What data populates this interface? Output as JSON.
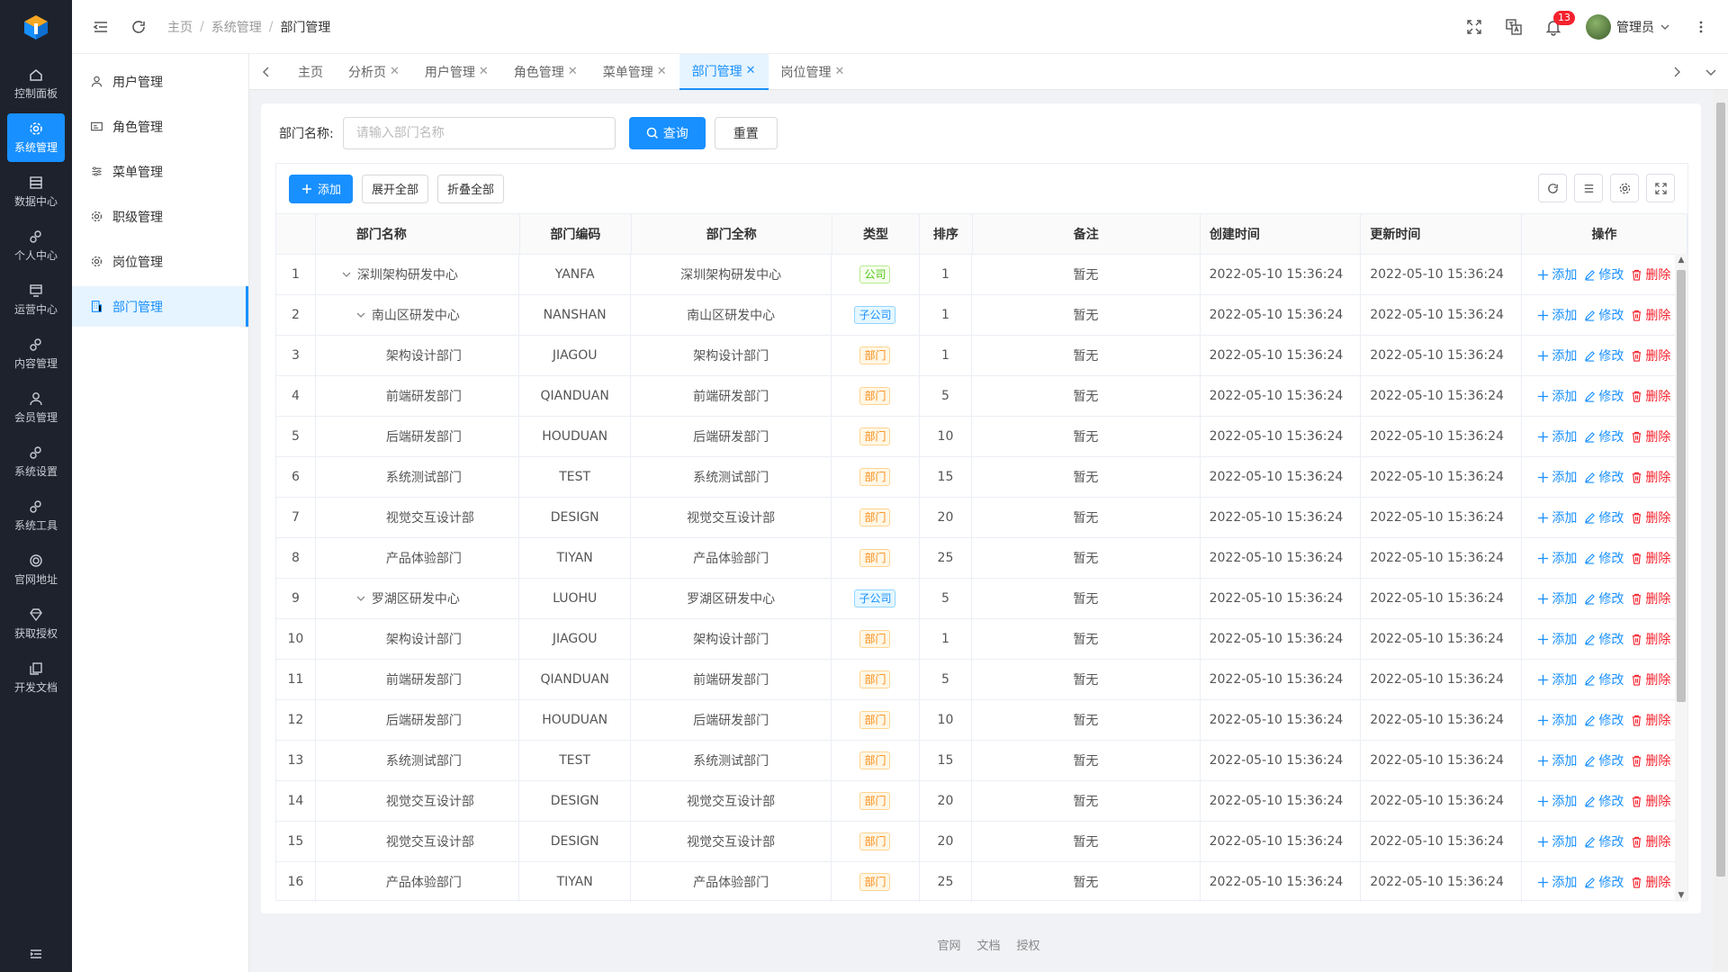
{
  "rail": {
    "items": [
      {
        "label": "控制面板",
        "icon": "home-icon",
        "active": false
      },
      {
        "label": "系统管理",
        "icon": "gear-icon",
        "active": true
      },
      {
        "label": "数据中心",
        "icon": "database-icon",
        "active": false
      },
      {
        "label": "个人中心",
        "icon": "gears-icon",
        "active": false
      },
      {
        "label": "运营中心",
        "icon": "monitor-icon",
        "active": false
      },
      {
        "label": "内容管理",
        "icon": "gears-icon",
        "active": false
      },
      {
        "label": "会员管理",
        "icon": "user-icon",
        "active": false
      },
      {
        "label": "系统设置",
        "icon": "gears-icon",
        "active": false
      },
      {
        "label": "系统工具",
        "icon": "gears-icon",
        "active": false
      },
      {
        "label": "官网地址",
        "icon": "target-icon",
        "active": false
      },
      {
        "label": "获取授权",
        "icon": "diamond-icon",
        "active": false
      },
      {
        "label": "开发文档",
        "icon": "copy-icon",
        "active": false
      }
    ]
  },
  "submenu": {
    "items": [
      {
        "label": "用户管理",
        "icon": "user-icon",
        "active": false
      },
      {
        "label": "角色管理",
        "icon": "id-card-icon",
        "active": false
      },
      {
        "label": "菜单管理",
        "icon": "sliders-icon",
        "active": false
      },
      {
        "label": "职级管理",
        "icon": "gear-icon",
        "active": false
      },
      {
        "label": "岗位管理",
        "icon": "gear-icon",
        "active": false
      },
      {
        "label": "部门管理",
        "icon": "building-icon",
        "active": true
      }
    ]
  },
  "header": {
    "breadcrumb": [
      "主页",
      "系统管理",
      "部门管理"
    ],
    "notification_count": "13",
    "user_name": "管理员"
  },
  "tabs": [
    {
      "label": "主页",
      "closable": false,
      "active": false
    },
    {
      "label": "分析页",
      "closable": true,
      "active": false
    },
    {
      "label": "用户管理",
      "closable": true,
      "active": false
    },
    {
      "label": "角色管理",
      "closable": true,
      "active": false
    },
    {
      "label": "菜单管理",
      "closable": true,
      "active": false
    },
    {
      "label": "部门管理",
      "closable": true,
      "active": true
    },
    {
      "label": "岗位管理",
      "closable": true,
      "active": false
    }
  ],
  "search": {
    "label": "部门名称:",
    "placeholder": "请输入部门名称",
    "value": "",
    "query_label": "查询",
    "reset_label": "重置"
  },
  "toolbar": {
    "add_label": "添加",
    "expand_label": "展开全部",
    "collapse_label": "折叠全部"
  },
  "table": {
    "columns": [
      "部门名称",
      "部门编码",
      "部门全称",
      "类型",
      "排序",
      "备注",
      "创建时间",
      "更新时间",
      "操作"
    ],
    "ops": {
      "add": "添加",
      "edit": "修改",
      "delete": "删除"
    },
    "rows": [
      {
        "idx": "1",
        "name": "深圳架构研发中心",
        "level": 0,
        "expand": true,
        "code": "YANFA",
        "full": "深圳架构研发中心",
        "type": "公司",
        "tag": "company",
        "sort": "1",
        "remark": "暂无",
        "created": "2022-05-10 15:36:24",
        "updated": "2022-05-10 15:36:24"
      },
      {
        "idx": "2",
        "name": "南山区研发中心",
        "level": 1,
        "expand": true,
        "code": "NANSHAN",
        "full": "南山区研发中心",
        "type": "子公司",
        "tag": "sub",
        "sort": "1",
        "remark": "暂无",
        "created": "2022-05-10 15:36:24",
        "updated": "2022-05-10 15:36:24"
      },
      {
        "idx": "3",
        "name": "架构设计部门",
        "level": 2,
        "expand": false,
        "code": "JIAGOU",
        "full": "架构设计部门",
        "type": "部门",
        "tag": "dept",
        "sort": "1",
        "remark": "暂无",
        "created": "2022-05-10 15:36:24",
        "updated": "2022-05-10 15:36:24"
      },
      {
        "idx": "4",
        "name": "前端研发部门",
        "level": 2,
        "expand": false,
        "code": "QIANDUAN",
        "full": "前端研发部门",
        "type": "部门",
        "tag": "dept",
        "sort": "5",
        "remark": "暂无",
        "created": "2022-05-10 15:36:24",
        "updated": "2022-05-10 15:36:24"
      },
      {
        "idx": "5",
        "name": "后端研发部门",
        "level": 2,
        "expand": false,
        "code": "HOUDUAN",
        "full": "后端研发部门",
        "type": "部门",
        "tag": "dept",
        "sort": "10",
        "remark": "暂无",
        "created": "2022-05-10 15:36:24",
        "updated": "2022-05-10 15:36:24"
      },
      {
        "idx": "6",
        "name": "系统测试部门",
        "level": 2,
        "expand": false,
        "code": "TEST",
        "full": "系统测试部门",
        "type": "部门",
        "tag": "dept",
        "sort": "15",
        "remark": "暂无",
        "created": "2022-05-10 15:36:24",
        "updated": "2022-05-10 15:36:24"
      },
      {
        "idx": "7",
        "name": "视觉交互设计部",
        "level": 2,
        "expand": false,
        "code": "DESIGN",
        "full": "视觉交互设计部",
        "type": "部门",
        "tag": "dept",
        "sort": "20",
        "remark": "暂无",
        "created": "2022-05-10 15:36:24",
        "updated": "2022-05-10 15:36:24"
      },
      {
        "idx": "8",
        "name": "产品体验部门",
        "level": 2,
        "expand": false,
        "code": "TIYAN",
        "full": "产品体验部门",
        "type": "部门",
        "tag": "dept",
        "sort": "25",
        "remark": "暂无",
        "created": "2022-05-10 15:36:24",
        "updated": "2022-05-10 15:36:24"
      },
      {
        "idx": "9",
        "name": "罗湖区研发中心",
        "level": 1,
        "expand": true,
        "code": "LUOHU",
        "full": "罗湖区研发中心",
        "type": "子公司",
        "tag": "sub",
        "sort": "5",
        "remark": "暂无",
        "created": "2022-05-10 15:36:24",
        "updated": "2022-05-10 15:36:24"
      },
      {
        "idx": "10",
        "name": "架构设计部门",
        "level": 2,
        "expand": false,
        "code": "JIAGOU",
        "full": "架构设计部门",
        "type": "部门",
        "tag": "dept",
        "sort": "1",
        "remark": "暂无",
        "created": "2022-05-10 15:36:24",
        "updated": "2022-05-10 15:36:24"
      },
      {
        "idx": "11",
        "name": "前端研发部门",
        "level": 2,
        "expand": false,
        "code": "QIANDUAN",
        "full": "前端研发部门",
        "type": "部门",
        "tag": "dept",
        "sort": "5",
        "remark": "暂无",
        "created": "2022-05-10 15:36:24",
        "updated": "2022-05-10 15:36:24"
      },
      {
        "idx": "12",
        "name": "后端研发部门",
        "level": 2,
        "expand": false,
        "code": "HOUDUAN",
        "full": "后端研发部门",
        "type": "部门",
        "tag": "dept",
        "sort": "10",
        "remark": "暂无",
        "created": "2022-05-10 15:36:24",
        "updated": "2022-05-10 15:36:24"
      },
      {
        "idx": "13",
        "name": "系统测试部门",
        "level": 2,
        "expand": false,
        "code": "TEST",
        "full": "系统测试部门",
        "type": "部门",
        "tag": "dept",
        "sort": "15",
        "remark": "暂无",
        "created": "2022-05-10 15:36:24",
        "updated": "2022-05-10 15:36:24"
      },
      {
        "idx": "14",
        "name": "视觉交互设计部",
        "level": 2,
        "expand": false,
        "code": "DESIGN",
        "full": "视觉交互设计部",
        "type": "部门",
        "tag": "dept",
        "sort": "20",
        "remark": "暂无",
        "created": "2022-05-10 15:36:24",
        "updated": "2022-05-10 15:36:24"
      },
      {
        "idx": "15",
        "name": "视觉交互设计部",
        "level": 2,
        "expand": false,
        "code": "DESIGN",
        "full": "视觉交互设计部",
        "type": "部门",
        "tag": "dept",
        "sort": "20",
        "remark": "暂无",
        "created": "2022-05-10 15:36:24",
        "updated": "2022-05-10 15:36:24"
      },
      {
        "idx": "16",
        "name": "产品体验部门",
        "level": 2,
        "expand": false,
        "code": "TIYAN",
        "full": "产品体验部门",
        "type": "部门",
        "tag": "dept",
        "sort": "25",
        "remark": "暂无",
        "created": "2022-05-10 15:36:24",
        "updated": "2022-05-10 15:36:24"
      }
    ]
  },
  "footer": {
    "links": [
      "官网",
      "文档",
      "授权"
    ]
  },
  "colors": {
    "primary": "#1890ff",
    "rail_bg": "#1e222d",
    "danger": "#f5222d"
  }
}
